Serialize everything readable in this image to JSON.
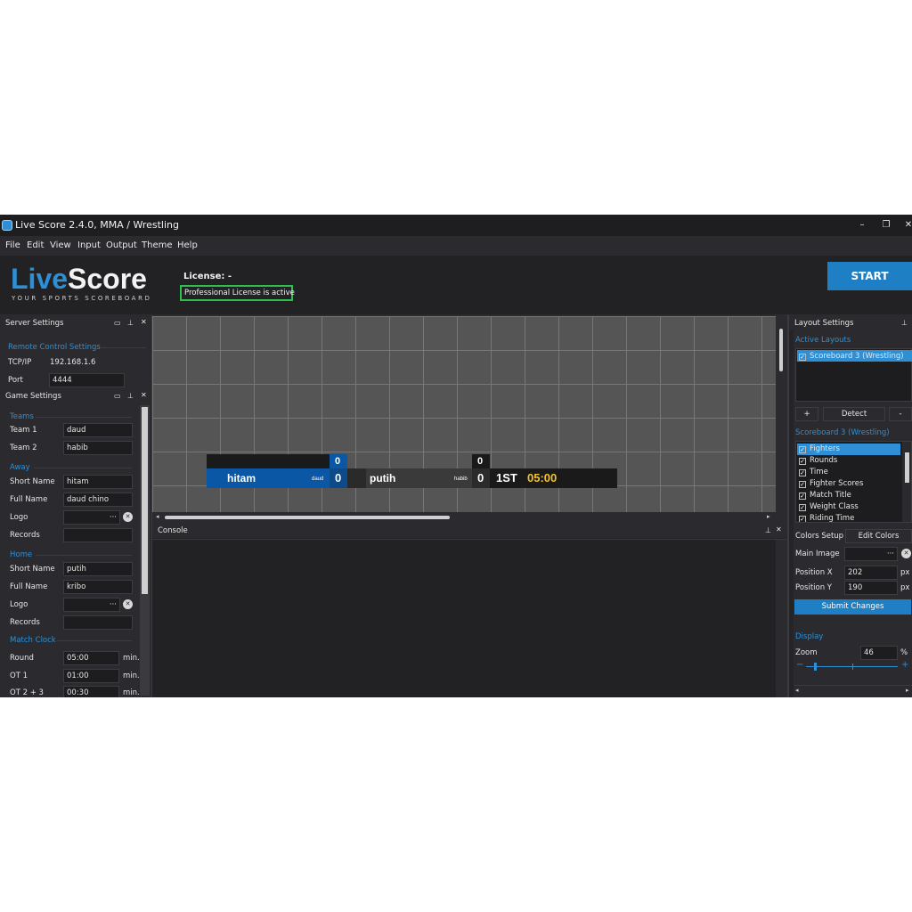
{
  "window": {
    "title": "Live Score 2.4.0, MMA / Wrestling",
    "minimize": "–",
    "restore": "❐",
    "close": "✕"
  },
  "menu": [
    "File",
    "Edit",
    "View",
    "Input",
    "Output",
    "Theme",
    "Help"
  ],
  "header": {
    "logo_live": "Live",
    "logo_score": "Score",
    "logo_tagline": "YOUR SPORTS SCOREBOARD",
    "license_label": "License: -",
    "license_status": "Professional License is active",
    "start_label": "START"
  },
  "server_settings": {
    "title": "Server Settings",
    "section": "Remote Control Settings",
    "tcp_label": "TCP/IP",
    "tcp_value": "192.168.1.6",
    "port_label": "Port",
    "port_value": "4444"
  },
  "game_settings": {
    "title": "Game Settings",
    "teams_section": "Teams",
    "team1_label": "Team 1",
    "team1_value": "daud",
    "team2_label": "Team 2",
    "team2_value": "habib",
    "away_section": "Away",
    "away_short_label": "Short Name",
    "away_short_value": "hitam",
    "away_full_label": "Full Name",
    "away_full_value": "daud chino",
    "away_logo_label": "Logo",
    "away_records_label": "Records",
    "home_section": "Home",
    "home_short_label": "Short Name",
    "home_short_value": "putih",
    "home_full_label": "Full Name",
    "home_full_value": "kribo",
    "home_logo_label": "Logo",
    "home_records_label": "Records",
    "clock_section": "Match Clock",
    "round_label": "Round",
    "round_value": "05:00",
    "ot1_label": "OT 1",
    "ot1_value": "01:00",
    "ot23_label": "OT 2 + 3",
    "ot23_value": "00:30",
    "unit": "min.",
    "dots": "···",
    "clear": "✕"
  },
  "scoreboard": {
    "away_name": "hitam",
    "away_full": "daud",
    "away_score": "0",
    "away_top_score": "0",
    "home_name": "putih",
    "home_full": "habib",
    "home_score": "0",
    "home_top_score": "0",
    "period": "1ST",
    "clock": "05:00",
    "colors": {
      "away": "#0a57a5",
      "home": "#3a3a3a",
      "clock": "#f2c230",
      "dark": "#1a1a1a"
    }
  },
  "console": {
    "title": "Console"
  },
  "layout_settings": {
    "title": "Layout Settings",
    "active_section": "Active Layouts",
    "active_item": "Scoreboard 3 (Wrestling)",
    "add": "+",
    "detect": "Detect",
    "remove": "-",
    "layout_section": "Scoreboard 3 (Wrestling)",
    "items": [
      "Fighters",
      "Rounds",
      "Time",
      "Fighter Scores",
      "Match Title",
      "Weight Class",
      "Riding Time"
    ],
    "colors_label": "Colors Setup",
    "edit_colors": "Edit Colors",
    "main_image_label": "Main Image",
    "pos_x_label": "Position X",
    "pos_x_value": "202",
    "pos_y_label": "Position Y",
    "pos_y_value": "190",
    "px": "px",
    "submit": "Submit Changes",
    "display_section": "Display",
    "zoom_label": "Zoom",
    "zoom_value": "46",
    "zoom_unit": "%",
    "zoom_minus": "−",
    "zoom_plus": "+"
  },
  "accent": "#2f8fd4"
}
